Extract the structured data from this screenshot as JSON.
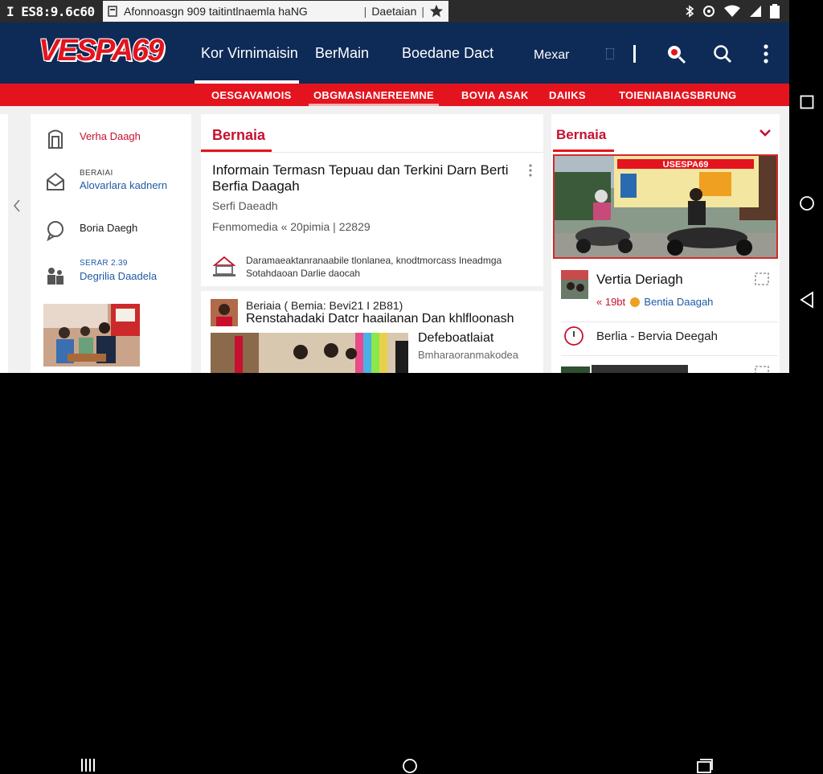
{
  "statusbar": {
    "time": "I ES8:9.6c60",
    "url": "Afonnoasgn 909 taitintlnaemla haNG",
    "url_tail": "Daetaian"
  },
  "header": {
    "logo": "VESPA69",
    "nav": [
      "Kor Virnimaisin",
      "BerMain",
      "Boedane Dact"
    ],
    "search_label": "Mexar"
  },
  "rednav": [
    "OESGAVAMOIS",
    "OBGMASIANEREEMNE",
    "BOVIA ASAK",
    "DAIIKS",
    "TOIENIABIAGSBRUNG"
  ],
  "sidebar": {
    "items": [
      {
        "label": "Verha Daagh"
      },
      {
        "sub": "BERAIAI",
        "label": "Alovarlara kadnern"
      },
      {
        "label": "Boria Daegh"
      },
      {
        "sub": "SERAR 2.39",
        "label": "Degrilia Daadela"
      }
    ]
  },
  "main": {
    "tab": "Bernaia",
    "title": "Informain Termasn Tepuau dan Terkini Darn Berti Berfia Daagah",
    "subtitle": "Serfi Daeadh",
    "meta": "Fenmomedia « 20pimia | 22829",
    "notice": "Daramaeaktanranaabile tlonlanea, knodtmorcass Ineadmga Sotahdaoan Darlie daocah",
    "card2": {
      "line1": "Beriaia ( Bemia: Bevi21 I 2B81)",
      "line2": "Renstahadaki Datcr haailanan Dan khlfloonash",
      "heading": "Defeboatlaiat",
      "sub": "Bmharaoranmakodea"
    }
  },
  "right": {
    "tab": "Bernaia",
    "item1_title": "Vertia Deriagh",
    "item1_meta_a": "« 19bt",
    "item1_meta_b": "Bentia Daagah",
    "item2": "Berlia - Bervia Deegah",
    "banner_text": "USESPA69"
  },
  "colors": {
    "header_bg": "#0e2b57",
    "accent_red": "#e4141e"
  }
}
